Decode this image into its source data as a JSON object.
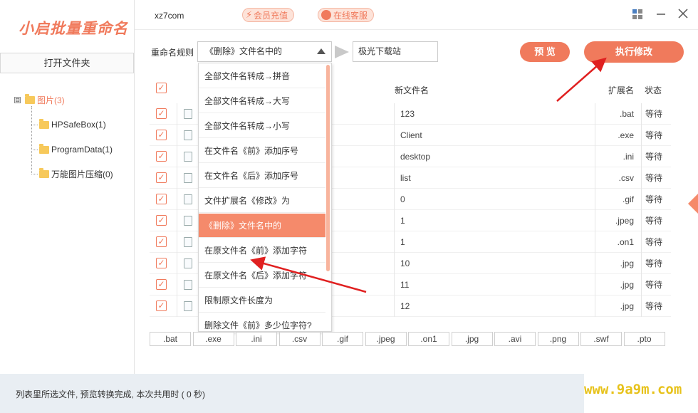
{
  "app": {
    "logo_text": "小启批量重命名",
    "site_name": "xz7com",
    "vip_label": "会员充值",
    "service_label": "在线客服"
  },
  "sidebar": {
    "open_folder_label": "打开文件夹",
    "tree": {
      "root": {
        "label": "图片(3)",
        "expander": "⊟"
      },
      "children": [
        {
          "label": "HPSafeBox(1)"
        },
        {
          "label": "ProgramData(1)"
        },
        {
          "label": "万能图片压缩(0)"
        }
      ]
    }
  },
  "toolbar": {
    "rule_label": "重命名规则",
    "rule_selected": "《删除》文件名中的",
    "text_value": "极光下载站",
    "preview_label": "预 览",
    "execute_label": "执行修改"
  },
  "dropdown": {
    "options": [
      "全部文件名转成→拼音",
      "全部文件名转成→大写",
      "全部文件名转成→小写",
      "在文件名《前》添加序号",
      "在文件名《后》添加序号",
      "文件扩展名《修改》为",
      "《删除》文件名中的",
      "在原文件名《前》添加字符",
      "在原文件名《后》添加字符",
      "限制原文件长度为",
      "删除文件《前》多少位字符?"
    ],
    "selected_index": 6
  },
  "table": {
    "headers": {
      "new_name": "新文件名",
      "ext": "扩展名",
      "status": "状态"
    },
    "check_mark": "✓",
    "rows": [
      {
        "new_name": "123",
        "ext": ".bat",
        "status": "等待"
      },
      {
        "new_name": "Client",
        "ext": ".exe",
        "status": "等待"
      },
      {
        "new_name": "desktop",
        "ext": ".ini",
        "status": "等待"
      },
      {
        "new_name": "list",
        "ext": ".csv",
        "status": "等待"
      },
      {
        "new_name": "0",
        "ext": ".gif",
        "status": "等待"
      },
      {
        "new_name": "1",
        "ext": ".jpeg",
        "status": "等待"
      },
      {
        "new_name": "1",
        "ext": ".on1",
        "status": "等待"
      },
      {
        "new_name": "10",
        "ext": ".jpg",
        "status": "等待"
      },
      {
        "new_name": "11",
        "ext": ".jpg",
        "status": "等待"
      },
      {
        "new_name": "12",
        "ext": ".jpg",
        "status": "等待"
      }
    ]
  },
  "extensions": [
    ".bat",
    ".exe",
    ".ini",
    ".csv",
    ".gif",
    ".jpeg",
    ".on1",
    ".jpg",
    ".avi",
    ".png",
    ".swf",
    ".pto"
  ],
  "status_bar": {
    "text": "列表里所选文件, 预览转换完成, 本次共用时 ( 0 秒)"
  },
  "watermark": {
    "text": "www.9a9m.com"
  },
  "colors": {
    "accent": "#f07a5c",
    "annotation_arrow": "#e02020"
  }
}
